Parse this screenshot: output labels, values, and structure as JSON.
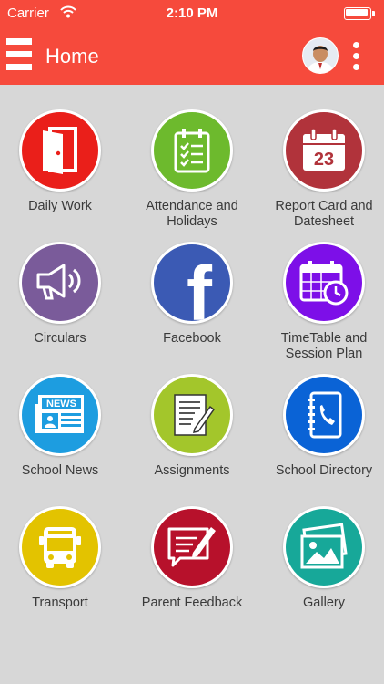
{
  "status_bar": {
    "carrier": "Carrier",
    "time": "2:10 PM"
  },
  "app_bar": {
    "title": "Home"
  },
  "tiles": [
    {
      "label": "Daily Work",
      "icon": "door-icon",
      "color": "#ea1f1a"
    },
    {
      "label": "Attendance and Holidays",
      "icon": "checklist-icon",
      "color": "#6dba2d"
    },
    {
      "label": "Report Card and Datesheet",
      "icon": "calendar-icon",
      "color": "#b1333b",
      "calendar_day": "23"
    },
    {
      "label": "Circulars",
      "icon": "megaphone-icon",
      "color": "#7a5b9a"
    },
    {
      "label": "Facebook",
      "icon": "facebook-icon",
      "color": "#3b5ab4",
      "glyph": "f"
    },
    {
      "label": "TimeTable and Session Plan",
      "icon": "schedule-icon",
      "color": "#7d0fe8"
    },
    {
      "label": "School News",
      "icon": "newspaper-icon",
      "color": "#1d9de0",
      "badge_text": "NEWS"
    },
    {
      "label": "Assignments",
      "icon": "assignment-icon",
      "color": "#a3c62b"
    },
    {
      "label": "School Directory",
      "icon": "phonebook-icon",
      "color": "#0a63d6"
    },
    {
      "label": "Transport",
      "icon": "bus-icon",
      "color": "#e3c300"
    },
    {
      "label": "Parent Feedback",
      "icon": "feedback-icon",
      "color": "#b7112b"
    },
    {
      "label": "Gallery",
      "icon": "gallery-icon",
      "color": "#17a899"
    }
  ]
}
